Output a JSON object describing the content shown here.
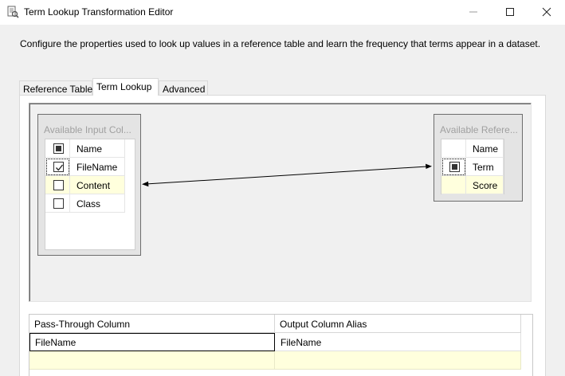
{
  "window": {
    "title": "Term Lookup Transformation Editor"
  },
  "description": "Configure the properties used to look up values in a reference table and learn the frequency that terms appear in a dataset.",
  "tabs": [
    {
      "label": "Reference Table",
      "active": false
    },
    {
      "label": "Term Lookup",
      "active": true
    },
    {
      "label": "Advanced",
      "active": false
    }
  ],
  "input_columns": {
    "title": "Available Input Col...",
    "header": "Name",
    "rows": [
      {
        "name": "FileName",
        "checked": true
      },
      {
        "name": "Content",
        "checked": false
      },
      {
        "name": "Class",
        "checked": false
      }
    ]
  },
  "reference_columns": {
    "title": "Available Refere...",
    "header": "Name",
    "rows": [
      {
        "name": "Term",
        "checked": "indeterminate"
      },
      {
        "name": "Score",
        "checked": null
      }
    ]
  },
  "output_grid": {
    "headers": [
      "Pass-Through Column",
      "Output Column Alias"
    ],
    "rows": [
      [
        "FileName",
        "FileName"
      ]
    ]
  },
  "colors": {
    "highlight_row": "#ffffdd",
    "window_bg": "#f0f0f0"
  }
}
